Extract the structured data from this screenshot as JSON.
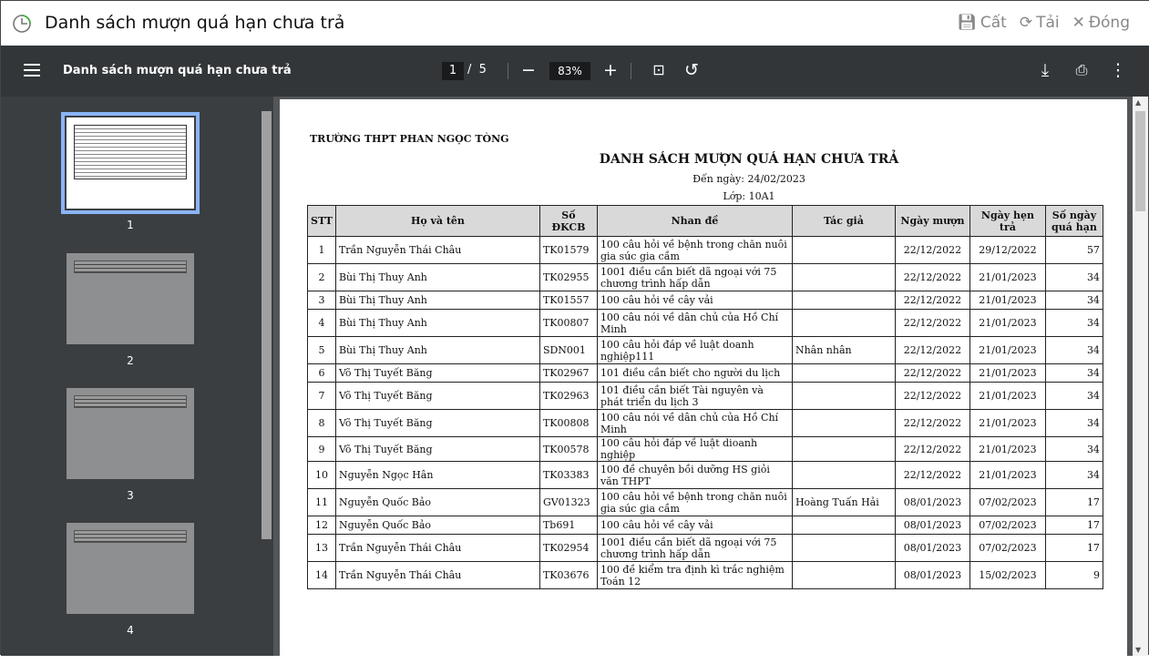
{
  "window": {
    "title": "Danh sách mượn quá hạn chưa trả",
    "actions": [
      {
        "icon": "save-icon",
        "label": "Cất"
      },
      {
        "icon": "refresh-icon",
        "label": "Tải"
      },
      {
        "icon": "close-icon",
        "label": "Đóng"
      }
    ]
  },
  "viewer": {
    "doc_title": "Danh sách mượn quá hạn chưa trả",
    "current_page": "1",
    "page_sep": "/",
    "total_pages": "5",
    "zoom": "83%",
    "minus": "−",
    "plus": "+"
  },
  "thumbnails": [
    "1",
    "2",
    "3",
    "4"
  ],
  "report": {
    "school": "TRƯỜNG THPT PHAN NGỌC TÒNG",
    "title": "DANH SÁCH MƯỢN QUÁ HẠN CHƯA TRẢ",
    "date_line": "Đến ngày: 24/02/2023",
    "class_line": "Lớp: 10A1",
    "columns": [
      "STT",
      "Họ và tên",
      "Số ĐKCB",
      "Nhan đề",
      "Tác giả",
      "Ngày mượn",
      "Ngày hẹn trả",
      "Số ngày quá hạn"
    ],
    "rows": [
      [
        "1",
        "Trần Nguyễn Thái Châu",
        "TK01579",
        "100 câu hỏi về bệnh trong chăn nuôi gia súc gia cầm",
        "",
        "22/12/2022",
        "29/12/2022",
        "57"
      ],
      [
        "2",
        "Bùi Thị Thuy Anh",
        "TK02955",
        "1001 điều cần biết dã ngoại với 75 chương trình hấp dẫn",
        "",
        "22/12/2022",
        "21/01/2023",
        "34"
      ],
      [
        "3",
        "Bùi Thị Thuy Anh",
        "TK01557",
        "100 câu  hỏi về cây vải",
        "",
        "22/12/2022",
        "21/01/2023",
        "34"
      ],
      [
        "4",
        "Bùi Thị Thuy Anh",
        "TK00807",
        "100 câu nói về dân chủ của Hồ Chí Minh",
        "",
        "22/12/2022",
        "21/01/2023",
        "34"
      ],
      [
        "5",
        "Bùi Thị Thuy Anh",
        "SDN001",
        "100 câu hỏi đáp về luật doanh nghiệp111",
        "Nhân nhân",
        "22/12/2022",
        "21/01/2023",
        "34"
      ],
      [
        "6",
        "Võ Thị Tuyết Băng",
        "TK02967",
        "101 điều cần biết  cho người du lịch",
        "",
        "22/12/2022",
        "21/01/2023",
        "34"
      ],
      [
        "7",
        "Võ Thị Tuyết Băng",
        "TK02963",
        "101 điều cần biết Tài nguyên và phát triển du lịch 3",
        "",
        "22/12/2022",
        "21/01/2023",
        "34"
      ],
      [
        "8",
        "Võ Thị Tuyết Băng",
        "TK00808",
        "100 câu nói về dân chủ của Hồ Chí Minh",
        "",
        "22/12/2022",
        "21/01/2023",
        "34"
      ],
      [
        "9",
        "Võ Thị Tuyết Băng",
        "TK00578",
        "100 câu hỏi đáp về luật dioanh nghiệp",
        "",
        "22/12/2022",
        "21/01/2023",
        "34"
      ],
      [
        "10",
        "Nguyễn Ngọc Hân",
        "TK03383",
        "100 đề chuyên bồi dưỡng HS giỏi văn THPT",
        "",
        "22/12/2022",
        "21/01/2023",
        "34"
      ],
      [
        "11",
        "Nguyễn Quốc Bảo",
        "GV01323",
        "100 câu hỏi về bệnh trong chăn nuôi gia súc gia cầm",
        "Hoàng Tuấn Hải",
        "08/01/2023",
        "07/02/2023",
        "17"
      ],
      [
        "12",
        "Nguyễn Quốc Bảo",
        "Tb691",
        "100 câu  hỏi về cây vải",
        "",
        "08/01/2023",
        "07/02/2023",
        "17"
      ],
      [
        "13",
        "Trần Nguyễn Thái Châu",
        "TK02954",
        "1001 điều cần biết dã ngoại với 75 chương trình hấp dẫn",
        "",
        "08/01/2023",
        "07/02/2023",
        "17"
      ],
      [
        "14",
        "Trần Nguyễn Thái Châu",
        "TK03676",
        "100 đề kiểm tra định kì trắc nghiệm Toán 12",
        "",
        "08/01/2023",
        "15/02/2023",
        "9"
      ]
    ]
  }
}
